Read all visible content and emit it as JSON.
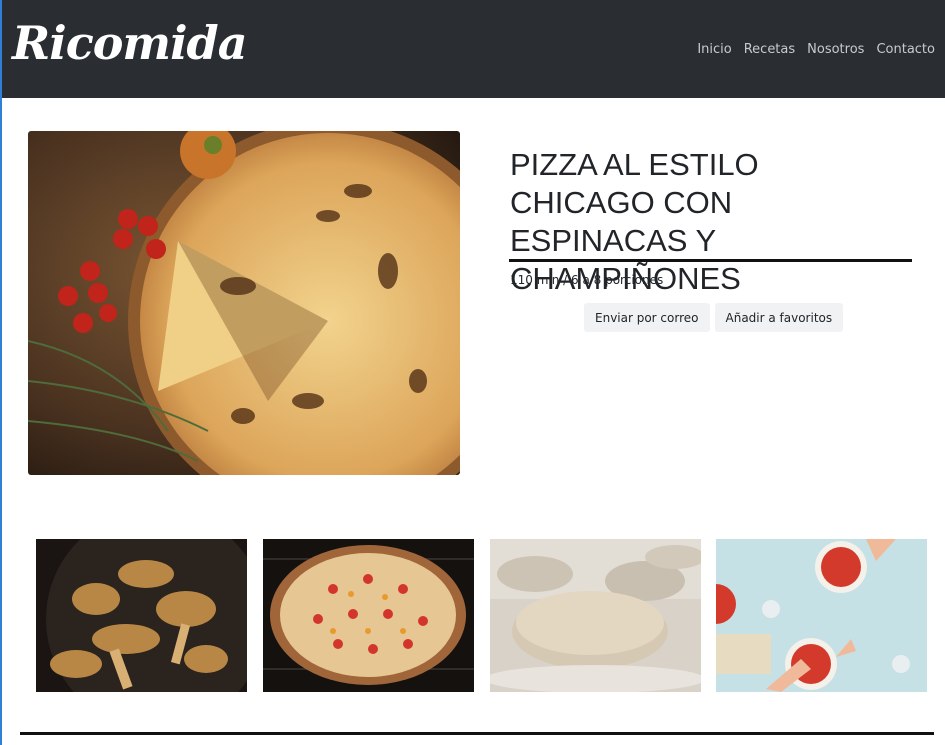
{
  "brand": "Ricomida",
  "nav": [
    "Inicio",
    "Recetas",
    "Nosotros",
    "Contacto"
  ],
  "recipe": {
    "title": "PIZZA AL ESTILO CHICAGO CON ESPINACAS Y CHAMPIÑONES",
    "meta": "110 min / 6 a 8 porciones"
  },
  "actions": {
    "email": "Enviar por correo",
    "favorite": "Añadir a favoritos"
  },
  "colors": {
    "navbar": "#2a2e33",
    "nav_link": "#c7cace",
    "button_bg": "#f1f2f4"
  }
}
